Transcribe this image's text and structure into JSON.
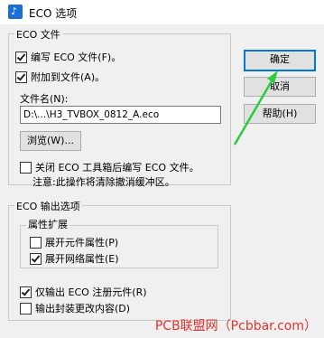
{
  "window": {
    "title": "ECO 选项",
    "icon": "app-icon"
  },
  "eco_file_group": {
    "legend": "ECO 文件",
    "write_eco": {
      "label": "编写 ECO 文件(F)。",
      "checked": true
    },
    "append": {
      "label": "附加到文件(A)。",
      "checked": true
    },
    "filename_label": "文件名(N):",
    "filename_value": "D:\\...\\H3_TVBOX_0812_A.eco",
    "browse_label": "浏览(W)...",
    "close_write": {
      "label": "关闭 ECO 工具箱后编写 ECO 文件。",
      "checked": false
    },
    "note": "注意:此操作将清除撤消缓冲区。"
  },
  "buttons": {
    "ok": "确定",
    "cancel": "取消",
    "help": "帮助(H)"
  },
  "output_group": {
    "legend": "ECO 输出选项",
    "attr_group": {
      "legend": "属性扩展",
      "expand_component": {
        "label": "展开元件属性(P)",
        "checked": false
      },
      "expand_net": {
        "label": "展开网络属性(E)",
        "checked": true
      }
    },
    "only_registered": {
      "label": "仅输出 ECO 注册元件(R)",
      "checked": true
    },
    "output_package": {
      "label": "输出封装更改内容(D)",
      "checked": false
    }
  },
  "watermark": "PCB联盟网（Pcbbar.com）",
  "colors": {
    "accent": "#0078d7",
    "arrow": "#2ecc40",
    "watermark": "#e5322d"
  }
}
